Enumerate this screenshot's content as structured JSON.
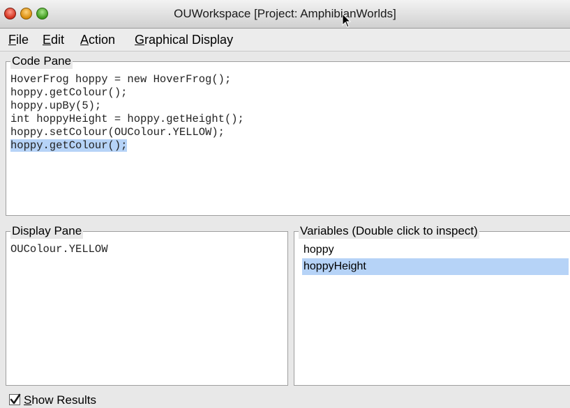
{
  "window": {
    "title": "OUWorkspace [Project: AmphibianWorlds]"
  },
  "menu": [
    {
      "mnemonic": "F",
      "rest": "ile"
    },
    {
      "mnemonic": "E",
      "rest": "dit"
    },
    {
      "mnemonic": "A",
      "rest": "ction"
    },
    {
      "mnemonic": "G",
      "rest": "raphical Display"
    }
  ],
  "code_pane": {
    "title": "Code Pane",
    "lines": [
      "HoverFrog hoppy = new HoverFrog();",
      "hoppy.getColour();",
      "hoppy.upBy(5);",
      "int hoppyHeight = hoppy.getHeight();",
      "hoppy.setColour(OUColour.YELLOW);",
      "hoppy.getColour();"
    ],
    "selected_line": "hoppy.getColour();"
  },
  "display_pane": {
    "title": "Display Pane",
    "text": "OUColour.YELLOW"
  },
  "variables_pane": {
    "title": "Variables (Double click to inspect)",
    "items": [
      "hoppy",
      "hoppyHeight"
    ],
    "selected_item": "hoppyHeight"
  },
  "footer": {
    "show_results_mnemonic": "S",
    "show_results_rest": "how Results",
    "show_results_checked": true
  },
  "colors": {
    "selection": "#b6d3f7",
    "close_button": "#d2301d",
    "minimize_button": "#d98c0c",
    "zoom_button": "#3f9a1e"
  }
}
